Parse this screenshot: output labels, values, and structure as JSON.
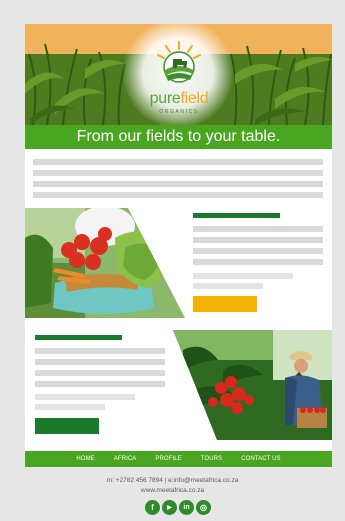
{
  "hero": {
    "brand_pure": "pure",
    "brand_field": "field",
    "brand_sub": "ORGANICS"
  },
  "tagline": "From our fields to your table.",
  "nav": {
    "items": [
      "HOME",
      "AFRICA",
      "PROFILE",
      "TOURS",
      "CONTACT US"
    ]
  },
  "footer": {
    "contact": "m: +2782 456 7894  |  e:info@meetafrica.co.za",
    "website": "www.meetafrica.co.za"
  },
  "social": [
    {
      "icon": "facebook-icon",
      "glyph": "f"
    },
    {
      "icon": "youtube-icon",
      "glyph": "▶"
    },
    {
      "icon": "linkedin-icon",
      "glyph": "in"
    },
    {
      "icon": "instagram-icon",
      "glyph": "◎"
    }
  ],
  "colors": {
    "brand_green": "#4aa520",
    "dark_green": "#1a7a2e",
    "gold": "#f5b300",
    "page_bg": "#e6e6e6"
  }
}
